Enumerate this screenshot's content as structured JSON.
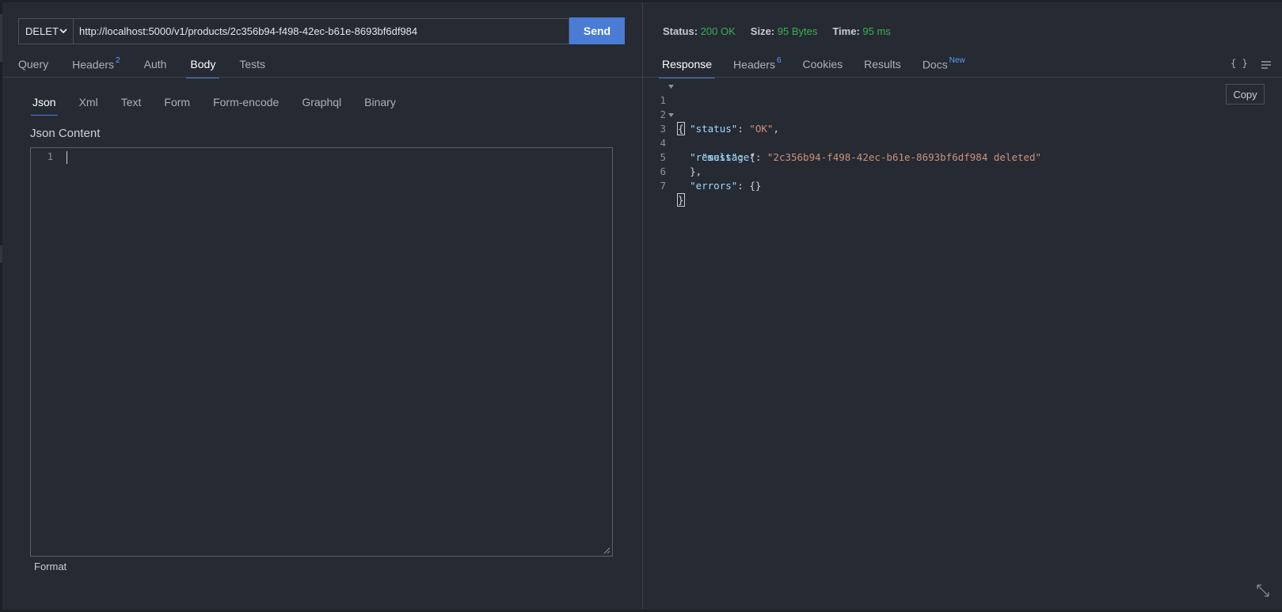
{
  "request": {
    "method": "DELETE",
    "url": "http://localhost:5000/v1/products/2c356b94-f498-42ec-b61e-8693bf6df984",
    "send_label": "Send",
    "tabs": [
      {
        "label": "Query",
        "badge": ""
      },
      {
        "label": "Headers",
        "badge": "2"
      },
      {
        "label": "Auth",
        "badge": ""
      },
      {
        "label": "Body",
        "badge": ""
      },
      {
        "label": "Tests",
        "badge": ""
      }
    ],
    "active_tab": "Body",
    "body_types": [
      "Json",
      "Xml",
      "Text",
      "Form",
      "Form-encode",
      "Graphql",
      "Binary"
    ],
    "active_body_type": "Json",
    "json_content_label": "Json Content",
    "editor_line_number": "1",
    "format_label": "Format"
  },
  "response": {
    "status_label": "Status:",
    "status_value": "200 OK",
    "size_label": "Size:",
    "size_value": "95 Bytes",
    "time_label": "Time:",
    "time_value": "95 ms",
    "tabs": [
      {
        "label": "Response",
        "badge": ""
      },
      {
        "label": "Headers",
        "badge": "6"
      },
      {
        "label": "Cookies",
        "badge": ""
      },
      {
        "label": "Results",
        "badge": ""
      },
      {
        "label": "Docs",
        "badge": "New"
      }
    ],
    "active_tab": "Response",
    "braces_icon_text": "{ }",
    "copy_label": "Copy",
    "code_lines": {
      "l1": {
        "n": "1",
        "open": "{"
      },
      "l2": {
        "n": "2",
        "key": "\"status\"",
        "colon": ": ",
        "val": "\"OK\"",
        "end": ","
      },
      "l3": {
        "n": "3",
        "key": "\"result\"",
        "colon": ": ",
        "end": "{"
      },
      "l4": {
        "n": "4",
        "key": "\"message\"",
        "colon": ": ",
        "val": "\"2c356b94-f498-42ec-b61e-8693bf6df984 deleted\""
      },
      "l5": {
        "n": "5",
        "text": "},"
      },
      "l6": {
        "n": "6",
        "key": "\"errors\"",
        "colon": ": ",
        "end": "{}"
      },
      "l7": {
        "n": "7",
        "close": "}"
      }
    }
  },
  "colors": {
    "background": "#262a33",
    "accent": "#4a7cd6",
    "success": "#37b24d",
    "badge": "#5aa0ff"
  }
}
